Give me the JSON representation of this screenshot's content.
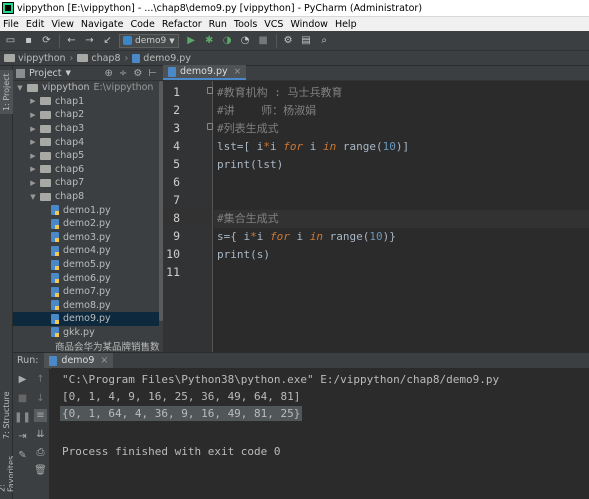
{
  "window": {
    "title": "vippython [E:\\vippython] - ...\\chap8\\demo9.py [vippython] - PyCharm (Administrator)"
  },
  "menu": [
    "File",
    "Edit",
    "View",
    "Navigate",
    "Code",
    "Refactor",
    "Run",
    "Tools",
    "VCS",
    "Window",
    "Help"
  ],
  "toolbar": {
    "run_config": "demo9"
  },
  "breadcrumb": [
    "vippython",
    "chap8",
    "demo9.py"
  ],
  "left_strip": {
    "project_tab": "1: Project",
    "structure_tab": "7: Structure",
    "favorites_tab": "2: Favorites"
  },
  "project_panel": {
    "title": "Project",
    "root_name": "vippython",
    "root_path": "E:\\vippython",
    "folders": [
      "chap1",
      "chap2",
      "chap3",
      "chap4",
      "chap5",
      "chap6",
      "chap7",
      "chap8"
    ],
    "files": [
      "demo1.py",
      "demo2.py",
      "demo3.py",
      "demo4.py",
      "demo5.py",
      "demo6.py",
      "demo7.py",
      "demo8.py",
      "demo9.py",
      "gkk.py",
      "商品会华为某品牌销售数据.x"
    ],
    "selected_file": "demo9.py"
  },
  "editor": {
    "tab_label": "demo9.py",
    "line_numbers": [
      "1",
      "2",
      "3",
      "4",
      "5",
      "6",
      "7",
      "8",
      "9",
      "10",
      "11"
    ],
    "lines": {
      "l1": "#教育机构 : 马士兵教育",
      "l2": "#讲    师：杨淑娟",
      "l3": "#列表生成式",
      "l4a": "lst",
      "l4b": "=[ i",
      "l4c": "*",
      "l4d": "i ",
      "l4e": "for",
      "l4f": " i ",
      "l4g": "in",
      "l4h": " range(",
      "l4i": "10",
      "l4j": ")]",
      "l5a": "print",
      "l5b": "(lst)",
      "l8": "#集合生成式",
      "l9a": "s",
      "l9b": "={ i",
      "l9c": "*",
      "l9d": "i ",
      "l9e": "for",
      "l9f": " i ",
      "l9g": "in",
      "l9h": " range(",
      "l9i": "10",
      "l9j": ")}",
      "l10a": "print",
      "l10b": "(s)"
    },
    "caret_line": 8
  },
  "run_panel": {
    "label": "Run:",
    "tab": "demo9",
    "output": [
      "\"C:\\Program Files\\Python38\\python.exe\" E:/vippython/chap8/demo9.py",
      "[0, 1, 4, 9, 16, 25, 36, 49, 64, 81]",
      "{0, 1, 64, 4, 36, 9, 16, 49, 81, 25}",
      "",
      "Process finished with exit code 0"
    ]
  }
}
